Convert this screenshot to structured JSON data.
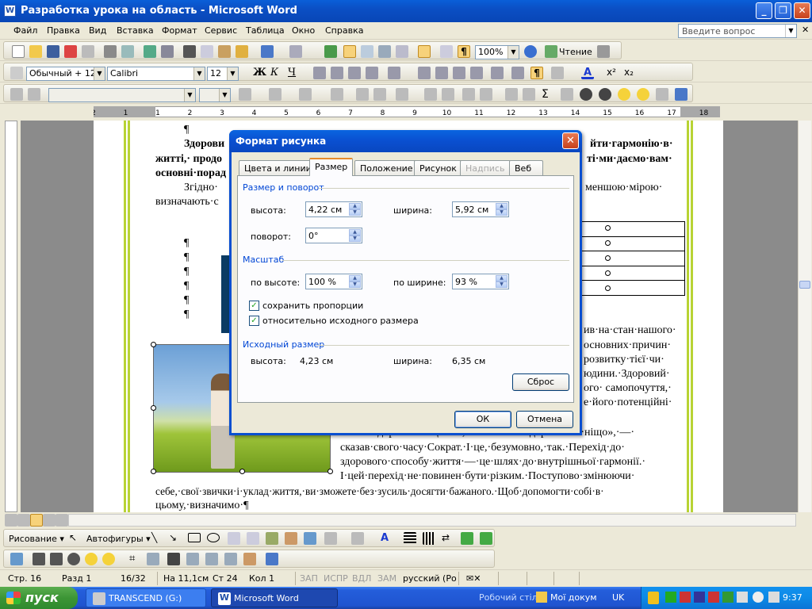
{
  "window": {
    "title": "Разработка урока на область - Microsoft Word",
    "app_icon": "W"
  },
  "menu": [
    "Файл",
    "Правка",
    "Вид",
    "Вставка",
    "Формат",
    "Сервис",
    "Таблица",
    "Окно",
    "Справка"
  ],
  "ask_placeholder": "Введите вопрос",
  "toolbar_standard": {
    "zoom": "100%",
    "reading_label": "Чтение"
  },
  "toolbar_formatting": {
    "style": "Обычный + 12 г",
    "font": "Calibri",
    "size": "12"
  },
  "ruler_numbers": [
    "2",
    "1",
    "1",
    "2",
    "3",
    "4",
    "5",
    "6",
    "7",
    "8",
    "9",
    "10",
    "11",
    "12",
    "13",
    "14",
    "15",
    "16",
    "17",
    "18"
  ],
  "document": {
    "lines": [
      {
        "text": "¶"
      },
      {
        "text": "Здорови",
        "bold": true
      },
      {
        "text": "житті,· продо",
        "bold": true
      },
      {
        "text": "основні·порад",
        "bold": true
      },
      {
        "text": "Згідно·"
      },
      {
        "text": "визначають·с"
      },
      {
        "text": "йти·гармонію·в·",
        "bold": true
      },
      {
        "text": "ті·ми·даємо·вам·",
        "bold": true
      },
      {
        "text": "меншою·мірою·"
      },
      {
        "text": "ив·на·стан·нашого·"
      },
      {
        "text": "основних·причин·"
      },
      {
        "text": "розвитку·тієї·чи·"
      },
      {
        "text": "юдини.·Здоровий·"
      },
      {
        "text": "ого·  самопочуття,·"
      },
      {
        "text": "е·його·потенційні·"
      },
      {
        "text": "«здоров’я·—·це·все,·але·все·без·здоров’я·—·ніщо»,·—·"
      },
      {
        "text": "сказав·свого·часу·Сократ.·І·це,·безумовно,·так.·Перехід·до·"
      },
      {
        "text": "здорового·способу·життя·—·це·шлях·до·внутрішньої·гармонії.·"
      },
      {
        "text": "І·цей·перехід·не·повинен·бути·різким.·Поступово·змінюючи·"
      },
      {
        "text": "себе,·свої·звички·і·уклад·життя,·ви·зможете·без·зусиль·досягти·бажаного.·Щоб·допомогти·собі·в·"
      },
      {
        "text": "цьому,·визначимо·¶"
      }
    ],
    "pilcrows": [
      "¶",
      "¶",
      "¶",
      "¶",
      "¶",
      "¶"
    ]
  },
  "dialog": {
    "title": "Формат рисунка",
    "tabs": [
      "Цвета и линии",
      "Размер",
      "Положение",
      "Рисунок",
      "Надпись",
      "Веб"
    ],
    "active_tab": "Размер",
    "section_size": "Размер и поворот",
    "height_label": "высота:",
    "height_value": "4,22 см",
    "width_label": "ширина:",
    "width_value": "5,92 см",
    "rotation_label": "поворот:",
    "rotation_value": "0°",
    "section_scale": "Масштаб",
    "scale_h_label": "по высоте:",
    "scale_h_value": "100 %",
    "scale_w_label": "по ширине:",
    "scale_w_value": "93 %",
    "check_lock": "сохранить пропорции",
    "check_relative": "относительно исходного размера",
    "section_original": "Исходный размер",
    "orig_h_label": "высота:",
    "orig_h_value": "4,23 см",
    "orig_w_label": "ширина:",
    "orig_w_value": "6,35 см",
    "reset": "Сброс",
    "ok": "ОК",
    "cancel": "Отмена"
  },
  "drawing_toolbar": {
    "drawing": "Рисование ▾",
    "autoshapes": "Автофигуры ▾"
  },
  "status": {
    "page": "Стр. 16",
    "section": "Разд 1",
    "pages": "16/32",
    "at": "На 11,1см",
    "line": "Ст 24",
    "col": "Кол 1",
    "rec": "ЗАП",
    "trk": "ИСПР",
    "ext": "ВДЛ",
    "ovr": "ЗАМ",
    "lang": "русский (Ро"
  },
  "taskbar": {
    "start": "пуск",
    "items": [
      "TRANSCEND (G:)",
      "Microsoft Word"
    ],
    "desktop": "Робочий стіл",
    "mydocs": "Мої докум",
    "lang": "UK",
    "clock": "9:37"
  }
}
